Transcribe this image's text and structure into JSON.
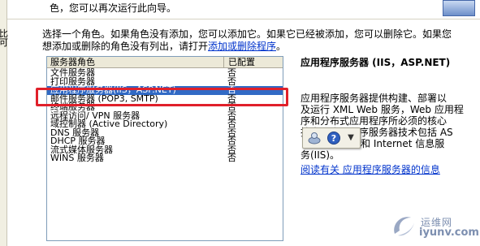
{
  "left_fragment": {
    "line1": "比",
    "line2": "可"
  },
  "top_banner": {
    "text": "色，您可以再次运行此向导。"
  },
  "intro": {
    "line1": "选择一个角色。如果角色没有添加，您可以添加它。如果它已经被添加，您可以删除它。如果您",
    "line2_prefix": "想添加或删除的角色没有列出，请打开",
    "line2_link": "添加或删除程序",
    "line2_suffix": "。"
  },
  "list": {
    "col_role": "服务器角色",
    "col_configured": "已配置",
    "rows": [
      {
        "role": "文件服务器",
        "configured": "否"
      },
      {
        "role": "打印服务器",
        "configured": "否"
      },
      {
        "role": "应用程序服务器(IIS，ASP.NET)",
        "configured": "否"
      },
      {
        "role": "邮件服务器 (POP3, SMTP)",
        "configured": "否"
      },
      {
        "role": "终端服务器",
        "configured": "否"
      },
      {
        "role": "远程访问/ VPN 服务器",
        "configured": "否"
      },
      {
        "role": "域控制器 (Active Directory)",
        "configured": "否"
      },
      {
        "role": "DNS 服务器",
        "configured": "否"
      },
      {
        "role": "DHCP 服务器",
        "configured": "否"
      },
      {
        "role": "流式媒体服务器",
        "configured": "否"
      },
      {
        "role": "WINS 服务器",
        "configured": "否"
      }
    ]
  },
  "details": {
    "title": "应用程序服务器 (IIS，ASP.NET)",
    "line1": "应用程序服务器提供构建、部署以",
    "line2": "及运行 XML Web 服务，Web 应用程",
    "line3": "序和分布式应用程序所必须的核心",
    "line4": "技术。应用程序服务器技术包括 AS",
    "line5": "和 Internet 信息服",
    "line6": "务(IIS)。",
    "link": "阅读有关 应用程序服务器的信息"
  },
  "watermark": {
    "text1": "运维网",
    "text2": "iyunv.com"
  },
  "colors": {
    "selection": "#316ac5",
    "highlight_border": "#e0202a",
    "link": "#0033cc"
  },
  "toolbar": {
    "icons": [
      "user-icon",
      "help-icon",
      "dropdown-arrow-icon"
    ]
  }
}
